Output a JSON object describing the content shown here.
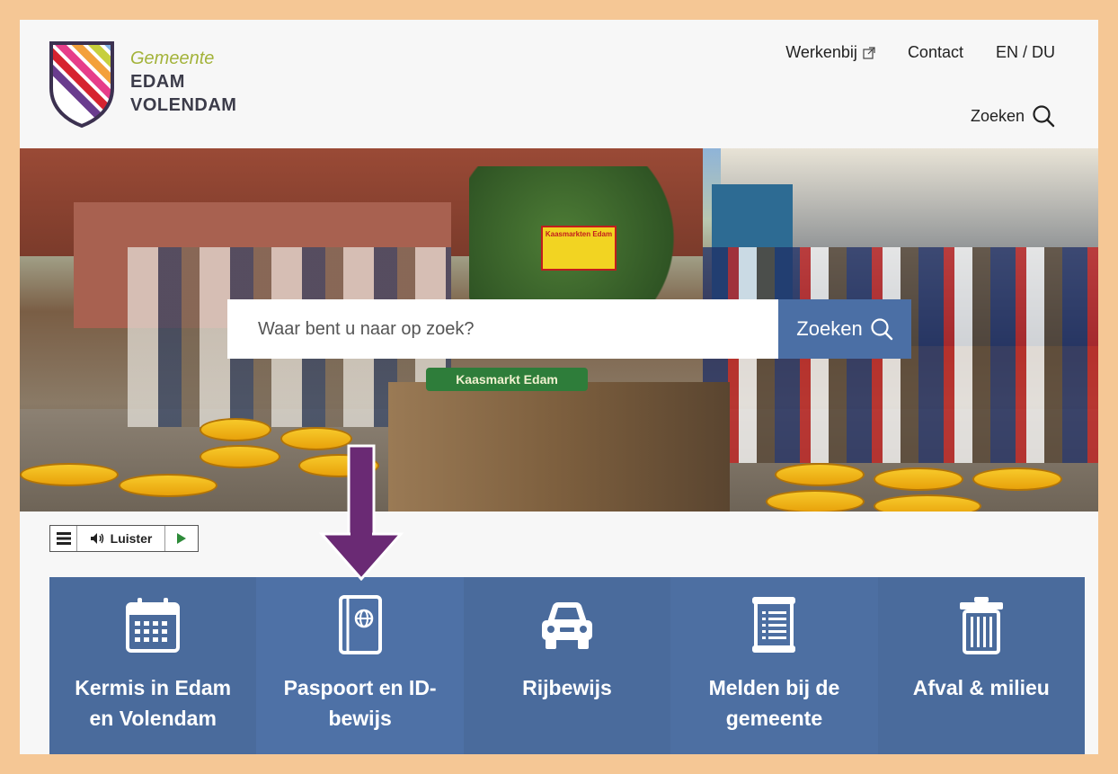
{
  "brand": {
    "subtitle": "Gemeente",
    "line1": "EDAM",
    "line2": "VOLENDAM"
  },
  "topnav": {
    "werkenbij": "Werkenbij",
    "contact": "Contact",
    "language": "EN / DU"
  },
  "header_search": {
    "label": "Zoeken"
  },
  "hero": {
    "sign_text": "Kaasmarkten Edam",
    "cart_label": "Kaasmarkt Edam"
  },
  "search": {
    "placeholder": "Waar bent u naar op zoek?",
    "button_label": "Zoeken"
  },
  "listen": {
    "label": "Luister"
  },
  "tiles": [
    {
      "label": "Kermis in Edam en Volendam",
      "icon": "calendar-icon"
    },
    {
      "label": "Paspoort en ID-bewijs",
      "icon": "passport-icon"
    },
    {
      "label": "Rijbewijs",
      "icon": "car-icon"
    },
    {
      "label": "Melden bij de gemeente",
      "icon": "document-icon"
    },
    {
      "label": "Afval & milieu",
      "icon": "trash-icon"
    }
  ],
  "colors": {
    "frame": "#f5c795",
    "tile_bg": "#4a6b9c",
    "search_button": "#4b6fa5",
    "arrow": "#6a2a74",
    "logo_green": "#a3b33a"
  }
}
